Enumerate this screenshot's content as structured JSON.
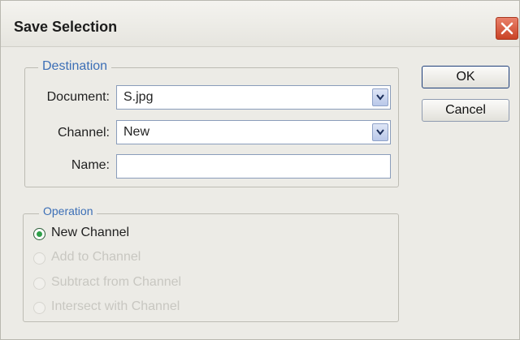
{
  "window": {
    "title": "Save Selection"
  },
  "destination": {
    "legend": "Destination",
    "document_label": "Document:",
    "document_value": "S.jpg",
    "channel_label": "Channel:",
    "channel_value": "New",
    "name_label": "Name:",
    "name_value": ""
  },
  "operation": {
    "legend": "Operation",
    "options": [
      {
        "label": "New Channel",
        "selected": true,
        "enabled": true
      },
      {
        "label": "Add to Channel",
        "selected": false,
        "enabled": false
      },
      {
        "label": "Subtract from Channel",
        "selected": false,
        "enabled": false
      },
      {
        "label": "Intersect with Channel",
        "selected": false,
        "enabled": false
      }
    ]
  },
  "buttons": {
    "ok_label": "OK",
    "cancel_label": "Cancel"
  },
  "colors": {
    "group_legend": "#3c6fb6",
    "selected_radio": "#2fa04a",
    "disabled_text": "#c8c7c1",
    "close_button": "#c94326"
  },
  "icons": {
    "close": "close-icon",
    "combo_arrow": "chevron-down-icon"
  }
}
